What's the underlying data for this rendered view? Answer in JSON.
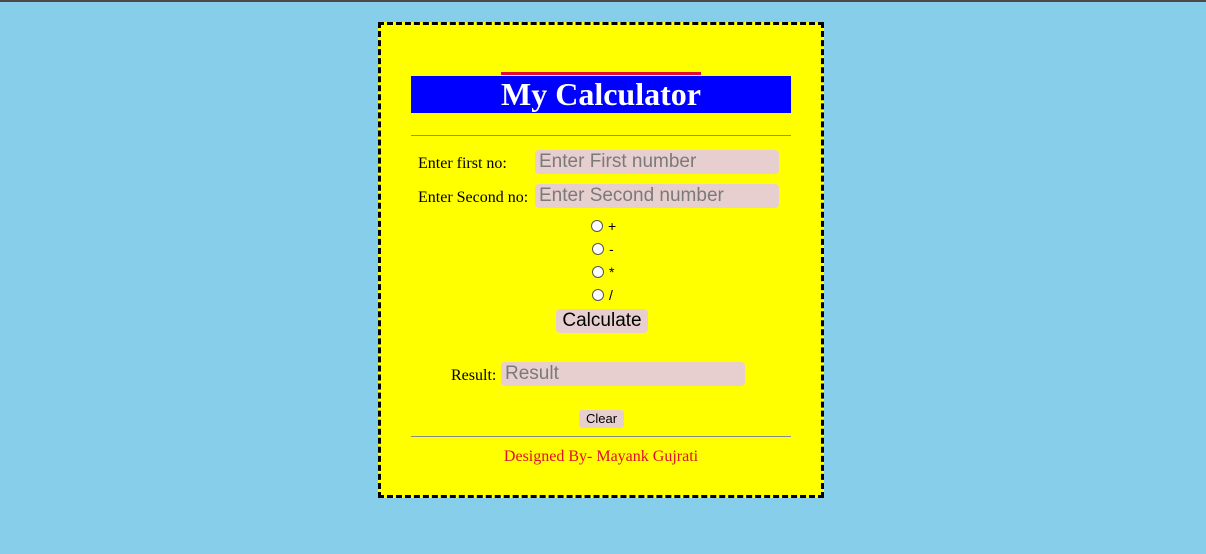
{
  "calculator": {
    "title": "My Calculator",
    "first_label": "Enter first no:",
    "first_placeholder": "Enter First number",
    "second_label": "Enter Second no:",
    "second_placeholder": "Enter Second number",
    "operators": [
      "+",
      "-",
      "*",
      "/"
    ],
    "calculate_label": "Calculate",
    "result_label": "Result:",
    "result_placeholder": "Result",
    "clear_label": "Clear",
    "footer": "Designed By- Mayank Gujrati"
  },
  "colors": {
    "page_background": "#87ceeb",
    "card_background": "#ffff00",
    "title_background": "#0000ff",
    "title_text": "#ffffff",
    "input_background": "#e8cfcf",
    "footer_text": "#e0102f"
  }
}
